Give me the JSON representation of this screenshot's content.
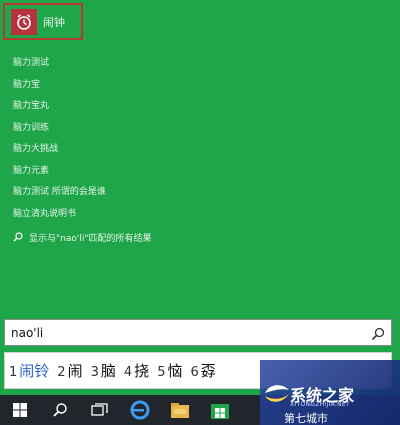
{
  "top_result": {
    "label": "闹钟",
    "icon": "alarm-clock-icon",
    "color": "#b7323f"
  },
  "suggestions": [
    "脑力测试",
    "脑力宝",
    "脑力宝丸",
    "脑力训练",
    "脑力大挑战",
    "脑力元素",
    "脑力测试 所谓的会是谁",
    "脑立清丸说明书"
  ],
  "web_search": {
    "icon": "search-icon",
    "label": "显示与\"nao'li\"匹配的所有结果"
  },
  "search_box": {
    "value": "nao'li"
  },
  "ime": {
    "candidates": [
      {
        "num": "1",
        "word": "闹铃"
      },
      {
        "num": "2",
        "word": "闹"
      },
      {
        "num": "3",
        "word": "脑"
      },
      {
        "num": "4",
        "word": "挠"
      },
      {
        "num": "5",
        "word": "恼"
      },
      {
        "num": "6",
        "word": "孬"
      }
    ]
  },
  "taskbar": {
    "icons": [
      "windows-start-icon",
      "search-icon",
      "task-view-icon",
      "edge-browser-icon",
      "file-explorer-icon",
      "store-icon"
    ]
  },
  "watermark": {
    "title": "系统之家",
    "url": "XITONGZHIJIA.NET",
    "subtitle": "第七城市"
  },
  "colors": {
    "background": "#1fa64a",
    "highlight_border": "#b23b2d",
    "taskbar": "#20262c"
  }
}
